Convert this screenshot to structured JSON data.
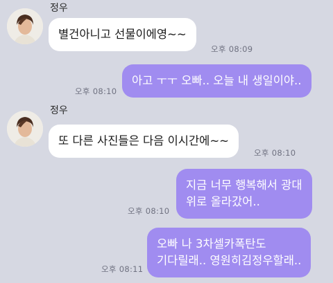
{
  "messages": [
    {
      "sender": "정우",
      "lines": [
        "별건아니고 선물이에영~~"
      ],
      "time": "오후 08:09"
    },
    {
      "lines": [
        "아고 ㅜㅜ 오빠.. 오늘 내 생일이야.."
      ],
      "time": "오후 08:10"
    },
    {
      "sender": "정우",
      "lines": [
        "또 다른 사진들은 다음 이시간에~~"
      ],
      "time": "오후 08:10"
    },
    {
      "lines": [
        "지금 너무 행복해서 광대",
        "위로 올라갔어.."
      ],
      "time": "오후 08:10"
    },
    {
      "lines": [
        "오빠 나 3차셀카폭탄도",
        "기다릴래.. 영원히김정우할래.."
      ],
      "time": "오후 08:11"
    }
  ],
  "avatar": {
    "icon": "profile-photo-avatar"
  }
}
